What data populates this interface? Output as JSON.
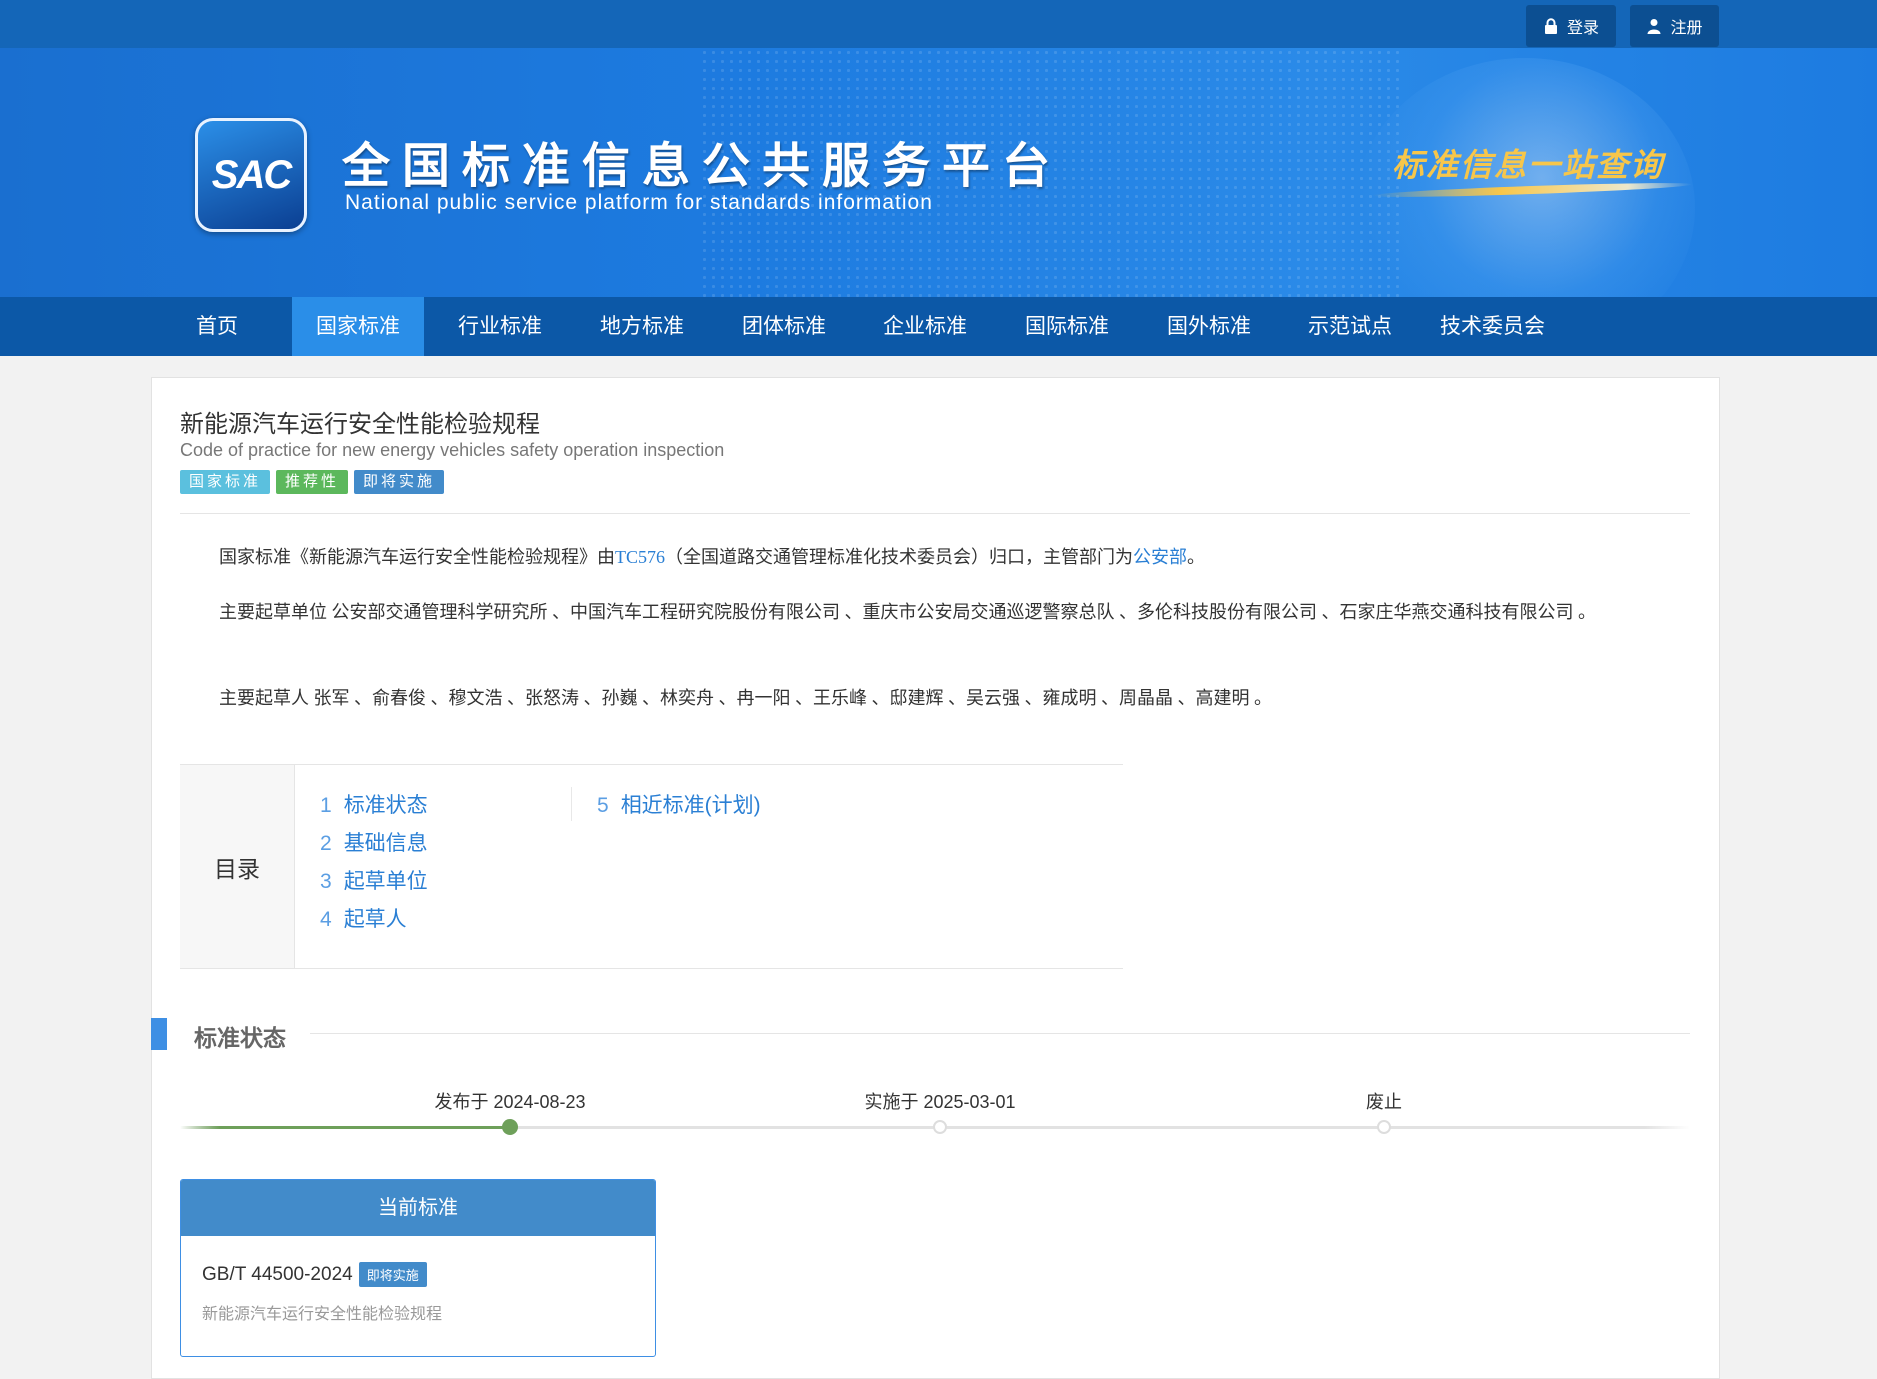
{
  "top": {
    "login_label": "登录",
    "register_label": "注册"
  },
  "banner": {
    "logo_text": "SAC",
    "title_cn": "全国标准信息公共服务平台",
    "title_en": "National public service platform  for standards information",
    "slogan": "标准信息一站查询"
  },
  "nav": {
    "items": [
      {
        "label": "首页"
      },
      {
        "label": "国家标准"
      },
      {
        "label": "行业标准"
      },
      {
        "label": "地方标准"
      },
      {
        "label": "团体标准"
      },
      {
        "label": "企业标准"
      },
      {
        "label": "国际标准"
      },
      {
        "label": "国外标准"
      },
      {
        "label": "示范试点"
      },
      {
        "label": "技术委员会"
      }
    ],
    "active": "国家标准"
  },
  "standard": {
    "title_cn": "新能源汽车运行安全性能检验规程",
    "title_en": "Code of practice for new energy vehicles safety operation inspection",
    "tags": [
      "国家标准",
      "推荐性",
      "即将实施"
    ]
  },
  "intro": {
    "p1_a": "国家标准《新能源汽车运行安全性能检验规程》由",
    "p1_link1": "TC576",
    "p1_b": "（全国道路交通管理标准化技术委员会）归口，主管部门为",
    "p1_link2": "公安部",
    "p1_c": "。",
    "p2": "主要起草单位 公安部交通管理科学研究所 、中国汽车工程研究院股份有限公司 、重庆市公安局交通巡逻警察总队 、多伦科技股份有限公司 、石家庄华燕交通科技有限公司 。",
    "p3": "主要起草人 张军 、俞春俊 、穆文浩 、张怒涛 、孙巍 、林奕舟 、冉一阳 、王乐峰 、邸建辉 、吴云强 、雍成明 、周晶晶 、高建明 。"
  },
  "toc": {
    "heading": "目录",
    "items": [
      {
        "num": "1",
        "label": "标准状态"
      },
      {
        "num": "2",
        "label": "基础信息"
      },
      {
        "num": "3",
        "label": "起草单位"
      },
      {
        "num": "4",
        "label": "起草人"
      },
      {
        "num": "5",
        "label": "相近标准(计划)"
      }
    ]
  },
  "status": {
    "section_title": "标准状态",
    "timeline": [
      {
        "label": "发布于 2024-08-23",
        "state": "done"
      },
      {
        "label": "实施于 2025-03-01",
        "state": "todo"
      },
      {
        "label": "废止",
        "state": "todo"
      }
    ],
    "current_heading": "当前标准",
    "current_code": "GB/T 44500-2024",
    "current_badge": "即将实施",
    "current_name": "新能源汽车运行安全性能检验规程"
  },
  "colors": {
    "brand_blue": "#1466b8",
    "nav_blue": "#0c58a7",
    "active_blue": "#2a8ee8",
    "link_blue": "#2a7fd4",
    "progress_green": "#6ea05a"
  }
}
